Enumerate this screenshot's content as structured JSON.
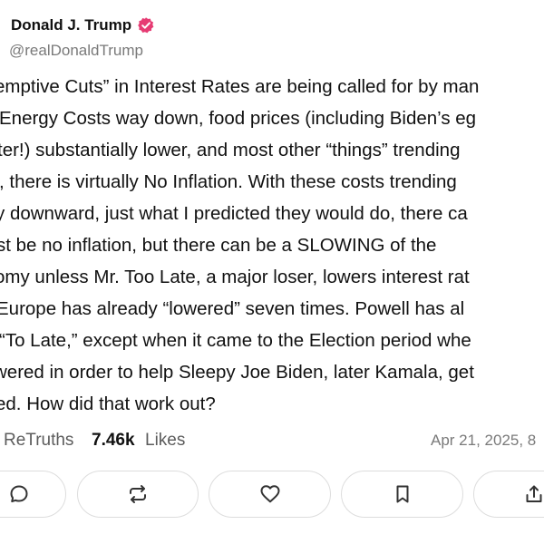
{
  "post": {
    "author": {
      "display_name": "Donald J. Trump",
      "handle": "@realDonaldTrump",
      "verified_icon": "verified-badge-icon",
      "verified_color": "#e63b73"
    },
    "lines": [
      "emptive Cuts” in Interest Rates are being called for by man",
      "Energy Costs way down, food prices (including Biden’s eg",
      "ter!) substantially lower, and most other “things” trending",
      ", there is virtually No Inflation. With these costs trending",
      "y downward, just what I predicted they would do, there ca",
      "st be no inflation, but there can be a SLOWING of the",
      "omy unless Mr. Too Late, a major loser, lowers interest rat",
      " Europe has already “lowered” seven times. Powell has al",
      " “To Late,” except when it came to the Election period whe",
      "wered in order to help Sleepy Joe Biden, later Kamala, get",
      "ed. How did that work out?"
    ],
    "stats": {
      "retruths_label": "ReTruths",
      "likes_count": "7.46k",
      "likes_label": "Likes",
      "date": "Apr 21, 2025, 8"
    },
    "actions": [
      {
        "name": "reply-button",
        "icon": "speech-bubble-icon"
      },
      {
        "name": "retruth-button",
        "icon": "repost-arrows-icon"
      },
      {
        "name": "like-button",
        "icon": "heart-icon"
      },
      {
        "name": "bookmark-button",
        "icon": "bookmark-icon"
      },
      {
        "name": "share-button",
        "icon": "share-upload-icon"
      }
    ],
    "colors": {
      "text": "#111111",
      "muted": "#7a7a7a",
      "border": "#dddddd"
    }
  }
}
